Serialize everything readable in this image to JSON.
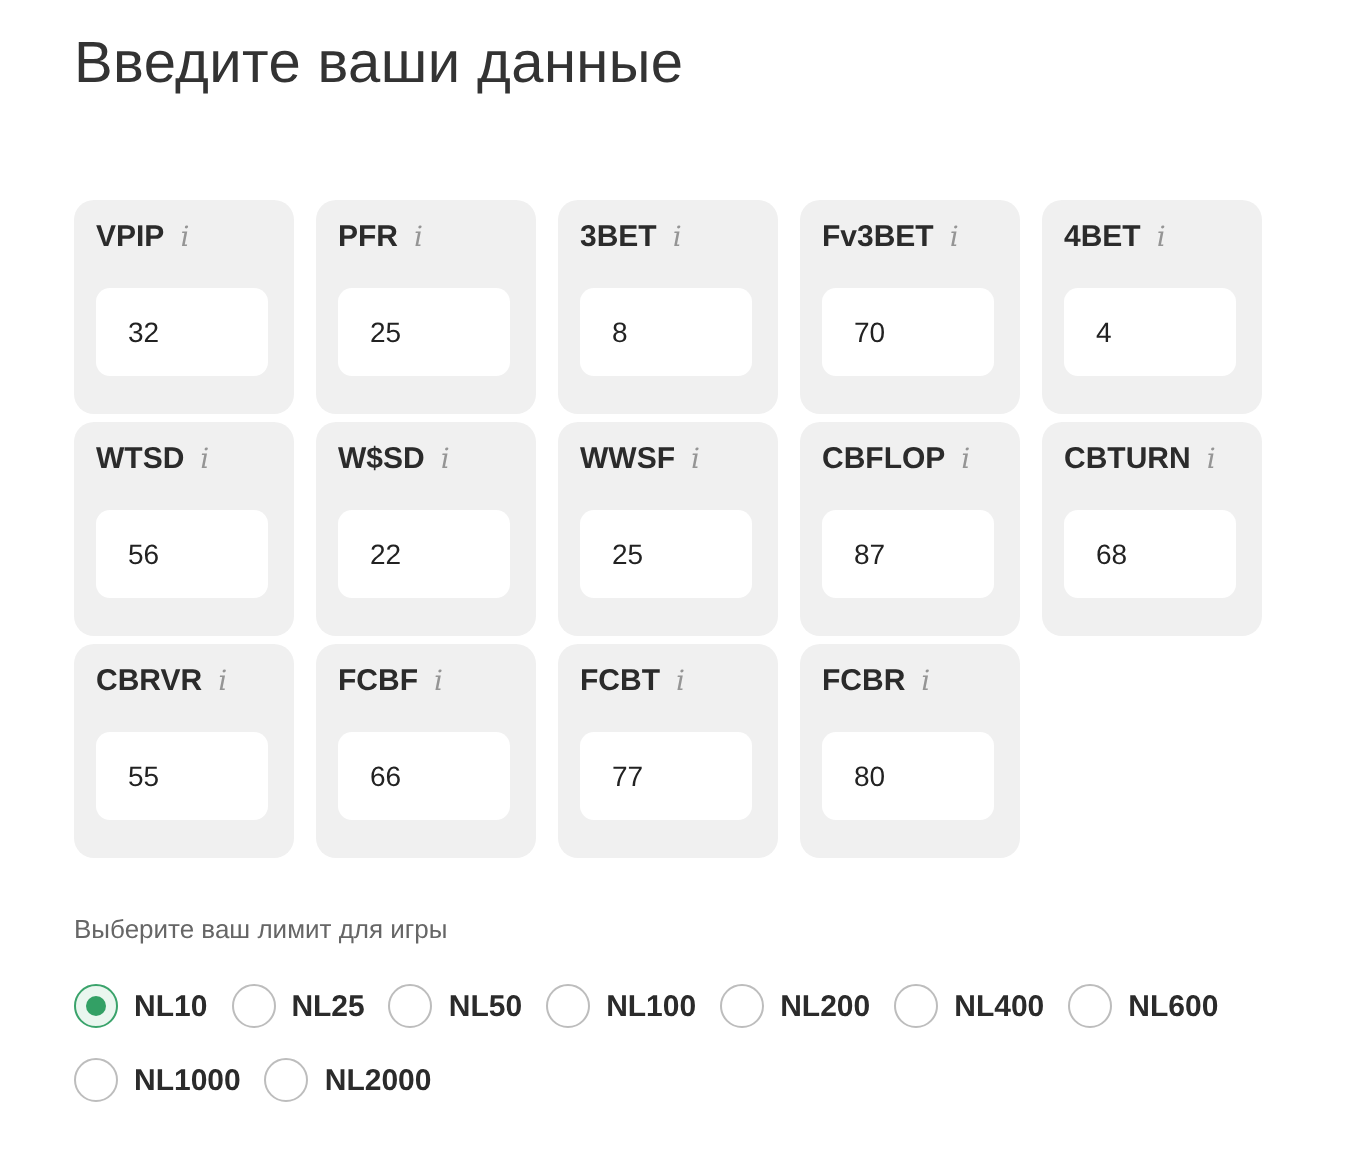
{
  "title": "Введите ваши данные",
  "stats": [
    {
      "label": "VPIP",
      "info": "i",
      "value": "32"
    },
    {
      "label": "PFR",
      "info": "i",
      "value": "25"
    },
    {
      "label": "3BET",
      "info": "i",
      "value": "8"
    },
    {
      "label": "Fv3BET",
      "info": "i",
      "value": "70"
    },
    {
      "label": "4BET",
      "info": "i",
      "value": "4"
    },
    {
      "label": "WTSD",
      "info": "i",
      "value": "56"
    },
    {
      "label": "W$SD",
      "info": "i",
      "value": "22"
    },
    {
      "label": "WWSF",
      "info": "i",
      "value": "25"
    },
    {
      "label": "CBFLOP",
      "info": "i",
      "value": "87"
    },
    {
      "label": "CBTURN",
      "info": "i",
      "value": "68"
    },
    {
      "label": "CBRVR",
      "info": "i",
      "value": "55"
    },
    {
      "label": "FCBF",
      "info": "i",
      "value": "66"
    },
    {
      "label": "FCBT",
      "info": "i",
      "value": "77"
    },
    {
      "label": "FCBR",
      "info": "i",
      "value": "80"
    }
  ],
  "limit_label": "Выберите ваш лимит для игры",
  "limits": [
    {
      "label": "NL10",
      "selected": true
    },
    {
      "label": "NL25",
      "selected": false
    },
    {
      "label": "NL50",
      "selected": false
    },
    {
      "label": "NL100",
      "selected": false
    },
    {
      "label": "NL200",
      "selected": false
    },
    {
      "label": "NL400",
      "selected": false
    },
    {
      "label": "NL600",
      "selected": false
    },
    {
      "label": "NL1000",
      "selected": false
    },
    {
      "label": "NL2000",
      "selected": false
    }
  ]
}
